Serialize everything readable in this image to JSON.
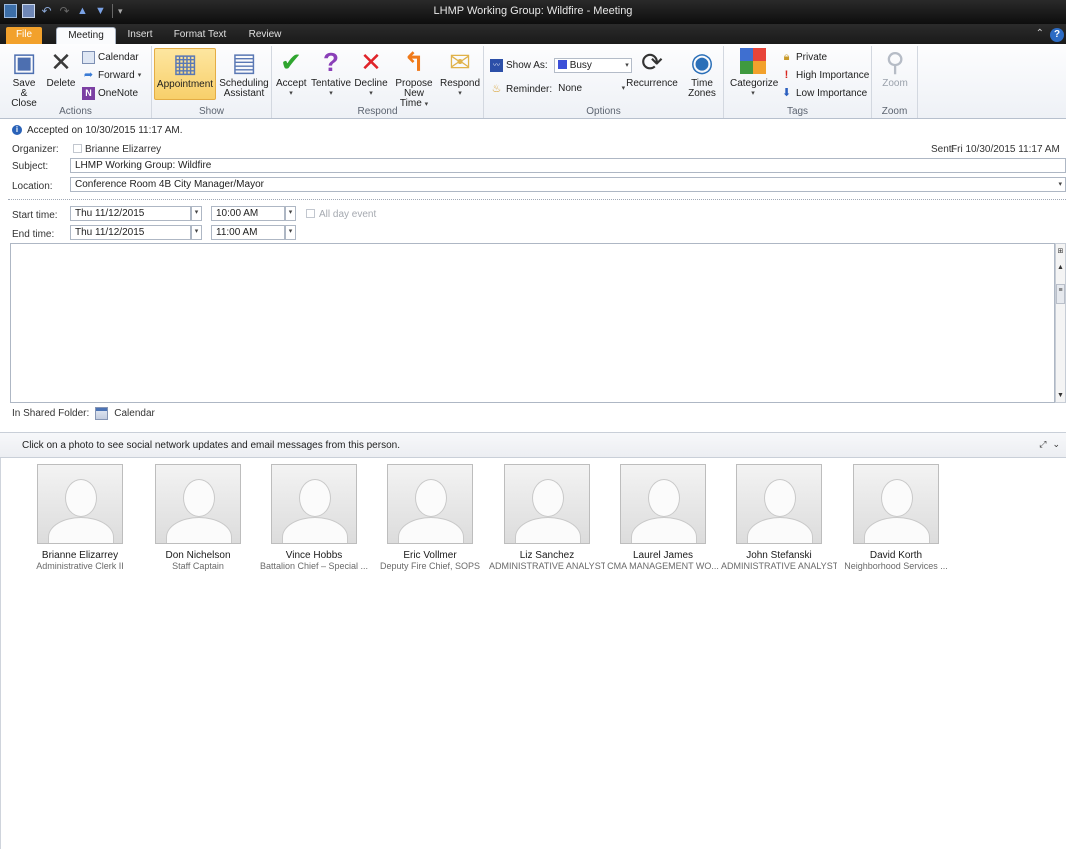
{
  "window": {
    "title": "LHMP Working Group: Wildfire - Meeting"
  },
  "tabs": {
    "file": "File",
    "meeting": "Meeting",
    "insert": "Insert",
    "format_text": "Format Text",
    "review": "Review"
  },
  "ribbon": {
    "actions": {
      "label": "Actions",
      "save_close_1": "Save &",
      "save_close_2": "Close",
      "delete": "Delete",
      "calendar": "Calendar",
      "forward": "Forward",
      "onenote": "OneNote"
    },
    "show": {
      "label": "Show",
      "appointment": "Appointment",
      "scheduling_1": "Scheduling",
      "scheduling_2": "Assistant"
    },
    "respond": {
      "label": "Respond",
      "accept": "Accept",
      "tentative": "Tentative",
      "decline": "Decline",
      "propose_1": "Propose",
      "propose_2": "New Time",
      "respond": "Respond"
    },
    "options": {
      "label": "Options",
      "show_as_label": "Show As:",
      "show_as_value": "Busy",
      "reminder_label": "Reminder:",
      "reminder_value": "None",
      "recurrence": "Recurrence",
      "time_zones_1": "Time",
      "time_zones_2": "Zones"
    },
    "tags": {
      "label": "Tags",
      "categorize": "Categorize",
      "private": "Private",
      "high_importance": "High Importance",
      "low_importance": "Low Importance"
    },
    "zoom": {
      "label": "Zoom",
      "zoom": "Zoom"
    }
  },
  "info": {
    "accepted": "Accepted on 10/30/2015 11:17 AM.",
    "organizer_label": "Organizer:",
    "organizer": "Brianne Elizarrey",
    "sent_label": "Sent:",
    "sent": "Fri 10/30/2015 11:17 AM",
    "subject_label": "Subject:",
    "subject": "LHMP Working Group: Wildfire",
    "location_label": "Location:",
    "location": "Conference Room 4B City Manager/Mayor",
    "start_label": "Start time:",
    "start_date": "Thu 11/12/2015",
    "start_time": "10:00 AM",
    "all_day": "All day event",
    "end_label": "End time:",
    "end_date": "Thu 11/12/2015",
    "end_time": "11:00 AM",
    "shared_folder_label": "In Shared Folder:",
    "shared_folder": "Calendar"
  },
  "social": {
    "prompt": "Click on a photo to see social network updates and email messages from this person.",
    "people": [
      {
        "name": "Brianne Elizarrey",
        "title": "Administrative Clerk II"
      },
      {
        "name": "Don Nichelson",
        "title": "Staff Captain"
      },
      {
        "name": "Vince Hobbs",
        "title": "Battalion Chief – Special ..."
      },
      {
        "name": "Eric Vollmer",
        "title": "Deputy Fire Chief, SOPS"
      },
      {
        "name": "Liz Sanchez",
        "title": "ADMINISTRATIVE ANALYST III"
      },
      {
        "name": "Laurel James",
        "title": "CMA MANAGEMENT WO..."
      },
      {
        "name": "John Stefanski",
        "title": "ADMINISTRATIVE ANALYST I"
      },
      {
        "name": "David Korth",
        "title": "Neighborhood Services ..."
      }
    ]
  },
  "colors": {
    "file_tab": "#f2a12c",
    "selected_button": "#f8cf6a",
    "info_icon": "#2a62b8",
    "accept": "#2fa52f",
    "tentative": "#8a3fb8",
    "decline": "#e0242a"
  }
}
